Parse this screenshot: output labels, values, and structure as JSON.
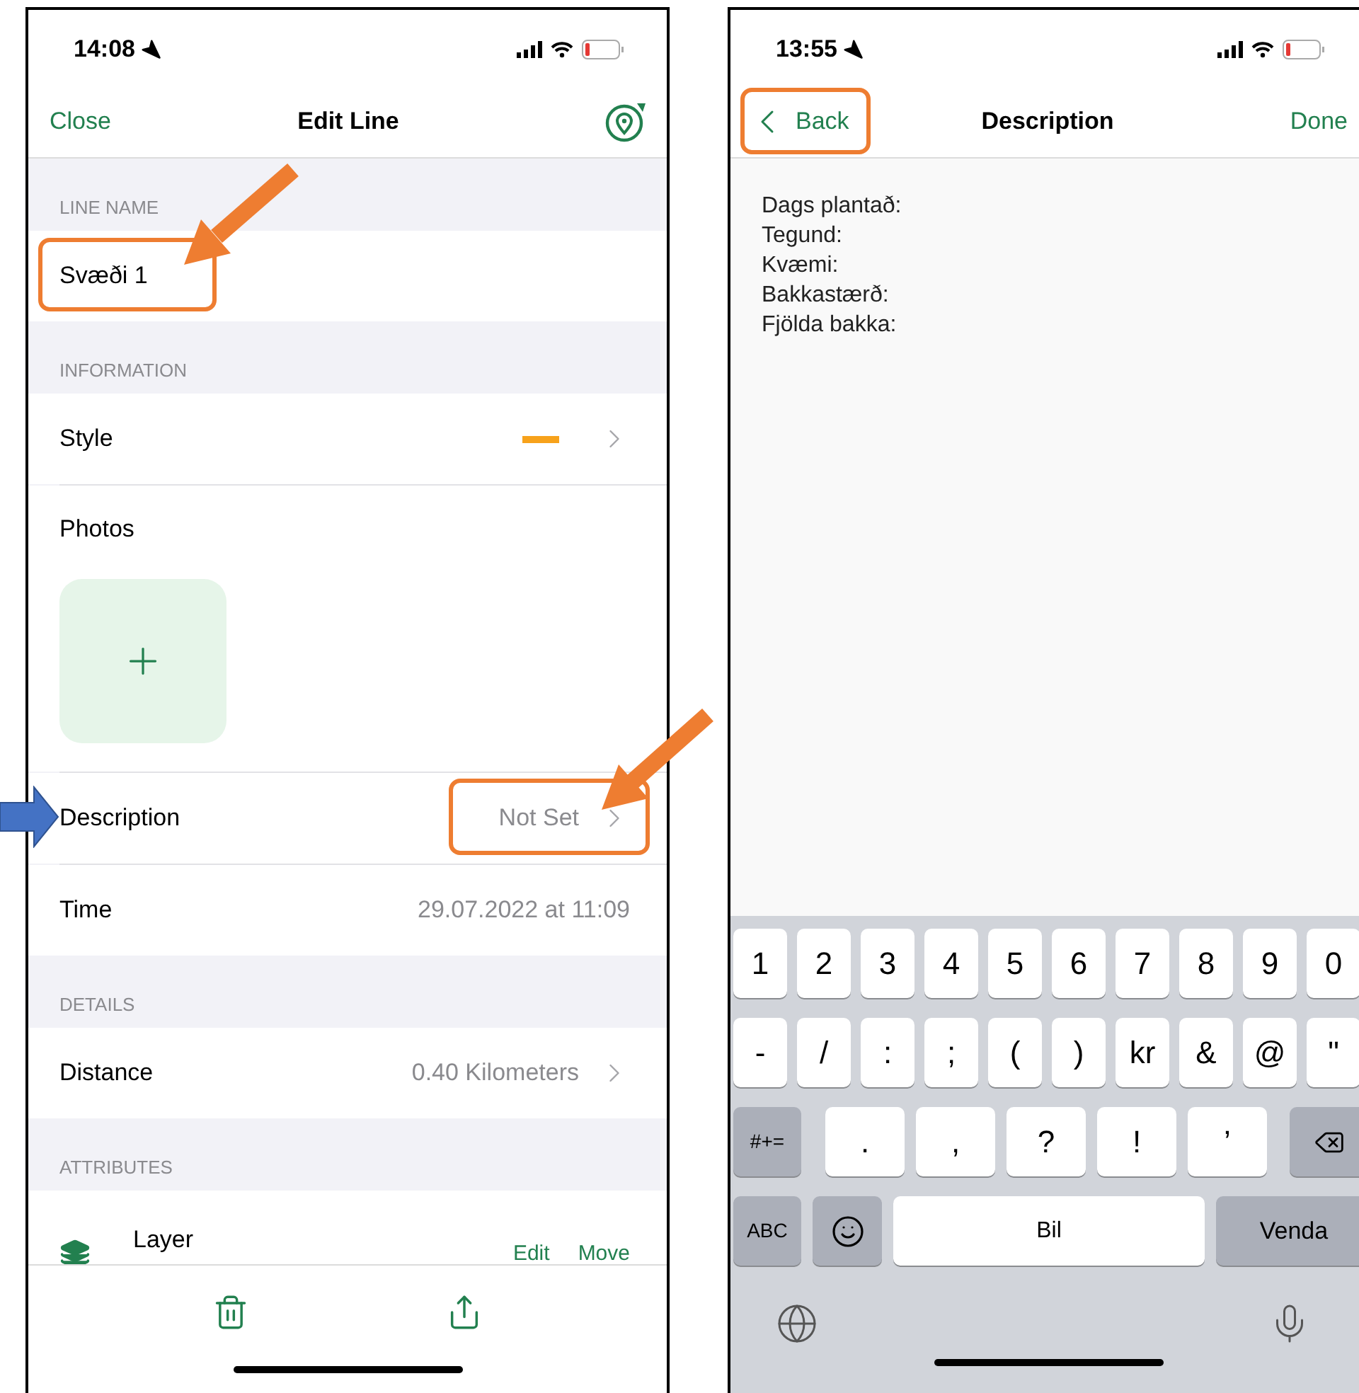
{
  "edit_line": {
    "status_bar": {
      "time": "14:08"
    },
    "nav_bar": {
      "close": "Close",
      "title": "Edit Line"
    },
    "sections": [
      {
        "header": "LINE NAME",
        "rows": [
          {
            "kind": "field",
            "value": "Svæði 1"
          }
        ]
      },
      {
        "header": "INFORMATION",
        "rows": [
          {
            "kind": "style",
            "label": "Style"
          },
          {
            "kind": "photos",
            "label": "Photos"
          },
          {
            "kind": "detail",
            "label": "Description",
            "value": "Not Set",
            "chevron": true
          },
          {
            "kind": "detail",
            "label": "Time",
            "value": "29.07.2022 at 11:09",
            "chevron": false
          }
        ]
      },
      {
        "header": "DETAILS",
        "rows": [
          {
            "kind": "detail",
            "label": "Distance",
            "value": "0.40 Kilometers",
            "chevron": true
          }
        ]
      },
      {
        "header": "ATTRIBUTES",
        "rows": [
          {
            "kind": "layer",
            "label": "Layer",
            "actions": [
              "Edit",
              "Move"
            ]
          }
        ]
      }
    ]
  },
  "description": {
    "status_bar": {
      "time": "13:55"
    },
    "nav_bar": {
      "back": "Back",
      "title": "Description",
      "done": "Done"
    },
    "text_lines": [
      "Dags plantað:",
      "Tegund:",
      "Kvæmi:",
      "Bakkastærð:",
      "Fjölda bakka:"
    ],
    "keyboard": {
      "number_row": [
        "1",
        "2",
        "3",
        "4",
        "5",
        "6",
        "7",
        "8",
        "9",
        "0"
      ],
      "symbol_row": [
        "-",
        "/",
        ":",
        ";",
        "(",
        ")",
        "kr",
        "&",
        "@",
        "\""
      ],
      "punctuation_row": [
        {
          "kind": "mode",
          "label": "#+="
        },
        {
          "kind": "key",
          "label": "."
        },
        {
          "kind": "key",
          "label": ","
        },
        {
          "kind": "key",
          "label": "?"
        },
        {
          "kind": "key",
          "label": "!"
        },
        {
          "kind": "key",
          "label": "’"
        },
        {
          "kind": "delete"
        }
      ],
      "bottom_row": [
        {
          "kind": "mode",
          "label": "ABC"
        },
        {
          "kind": "emoji"
        },
        {
          "kind": "space",
          "label": "Bil"
        },
        {
          "kind": "return",
          "label": "Venda"
        }
      ]
    }
  }
}
